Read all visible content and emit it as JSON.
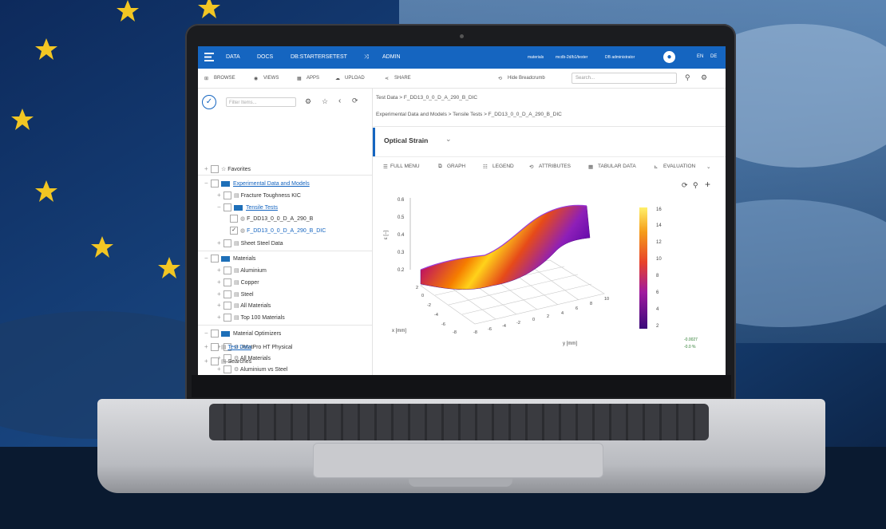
{
  "app": {
    "nav": [
      "DATA",
      "DOCS",
      "DB:STARTERSETEST",
      "ADMIN"
    ],
    "header_links": [
      "materials",
      "mcdb-2d/b1/tester",
      "DB administrator"
    ],
    "languages": [
      "EN",
      "DE"
    ]
  },
  "toolbar": {
    "items": [
      "BROWSE",
      "VIEWS",
      "APPS",
      "UPLOAD",
      "SHARE"
    ],
    "hide_breadcrumb": "Hide Breadcrumb",
    "search_placeholder": "Search..."
  },
  "tree": {
    "filter_placeholder": "Filter Items...",
    "items": [
      {
        "label": "Favorites",
        "style": "normal"
      },
      {
        "label": "Experimental Data and Models",
        "style": "link"
      },
      {
        "label": "Fracture Toughness KIC",
        "style": "normal"
      },
      {
        "label": "Tensile Tests",
        "style": "link"
      },
      {
        "label": "F_DD13_0_0_D_A_290_B",
        "style": "normal"
      },
      {
        "label": "F_DD13_0_0_D_A_290_B_DIC",
        "style": "selected"
      },
      {
        "label": "Sheet Steel Data",
        "style": "normal"
      },
      {
        "label": "Materials",
        "style": "normal"
      },
      {
        "label": "Aluminium",
        "style": "normal"
      },
      {
        "label": "Copper",
        "style": "normal"
      },
      {
        "label": "Steel",
        "style": "normal"
      },
      {
        "label": "All Materials",
        "style": "normal"
      },
      {
        "label": "Top 100 Materials",
        "style": "normal"
      },
      {
        "label": "Material Optimizers",
        "style": "normal"
      },
      {
        "label": "JMatPro HT Physical",
        "style": "normal"
      },
      {
        "label": "All Materials",
        "style": "normal"
      },
      {
        "label": "Aluminium vs Steel",
        "style": "normal"
      },
      {
        "label": "Test Data",
        "style": "link"
      },
      {
        "label": "Searches",
        "style": "normal"
      }
    ]
  },
  "main": {
    "breadcrumb1": "Test Data  >  F_DD13_0_0_D_A_290_B_DIC",
    "breadcrumb2": "Experimental Data and Models  >  Tensile Tests  >  F_DD13_0_0_D_A_290_B_DIC",
    "title": "Optical Strain",
    "tabs": [
      "FULL MENU",
      "GRAPH",
      "LEGEND",
      "ATTRIBUTES",
      "TABULAR DATA",
      "EVALUATION"
    ]
  },
  "chart_data": {
    "type": "surface3d",
    "z_axis_label": "ε [−]",
    "x_axis_label": "x [mm]",
    "y_axis_label": "y [mm]",
    "z_ticks": [
      "0.6",
      "0.5",
      "0.4",
      "0.3",
      "0.2"
    ],
    "x_ticks": [
      "2",
      "0",
      "-2",
      "-4",
      "-6",
      "-8"
    ],
    "y_ticks": [
      "-8",
      "-6",
      "-4",
      "-2",
      "0",
      "2",
      "4",
      "6",
      "8",
      "10"
    ],
    "colorbar_ticks": [
      "16",
      "14",
      "12",
      "10",
      "8",
      "6",
      "4",
      "2"
    ],
    "readouts": [
      "-0.0027",
      "-0.0 %"
    ],
    "colors": {
      "low": "#6a0dad",
      "mid": "#e0402a",
      "high": "#ffd21a"
    }
  }
}
